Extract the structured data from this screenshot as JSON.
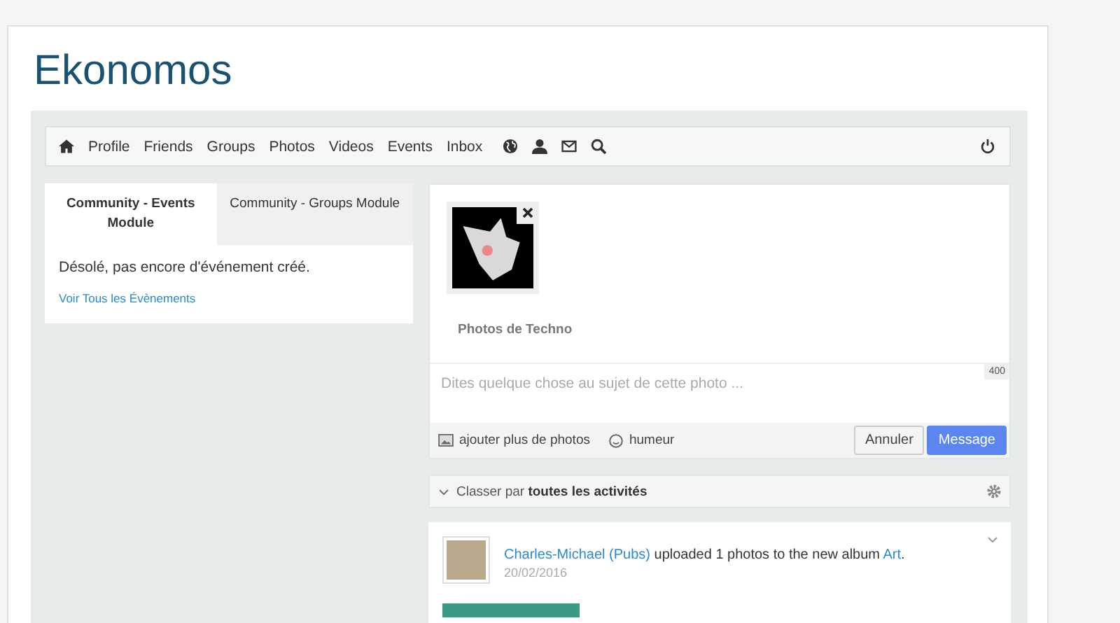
{
  "site_title": "Ekonomos",
  "nav": {
    "links": [
      "Profile",
      "Friends",
      "Groups",
      "Photos",
      "Videos",
      "Events",
      "Inbox"
    ]
  },
  "module_tabs": [
    {
      "label": "Community - Events Module",
      "selected": true
    },
    {
      "label": "Community - Groups Module",
      "selected": false
    }
  ],
  "module": {
    "message": "Désolé, pas encore d'événement créé.",
    "link": "Voir Tous les Évènements"
  },
  "composer": {
    "album_title": "Photos de Techno",
    "placeholder": "Dites quelque chose au sujet de cette photo ...",
    "char_count": "400",
    "add_photos": "ajouter plus de photos",
    "mood": "humeur",
    "cancel": "Annuler",
    "submit": "Message"
  },
  "filter": {
    "prefix": "Classer par",
    "value": "toutes les activités"
  },
  "activity": {
    "actor": "Charles-Michael (Pubs)",
    "text": "uploaded 1 photos to the new album",
    "album": "Art",
    "end": ".",
    "date": "20/02/2016"
  }
}
